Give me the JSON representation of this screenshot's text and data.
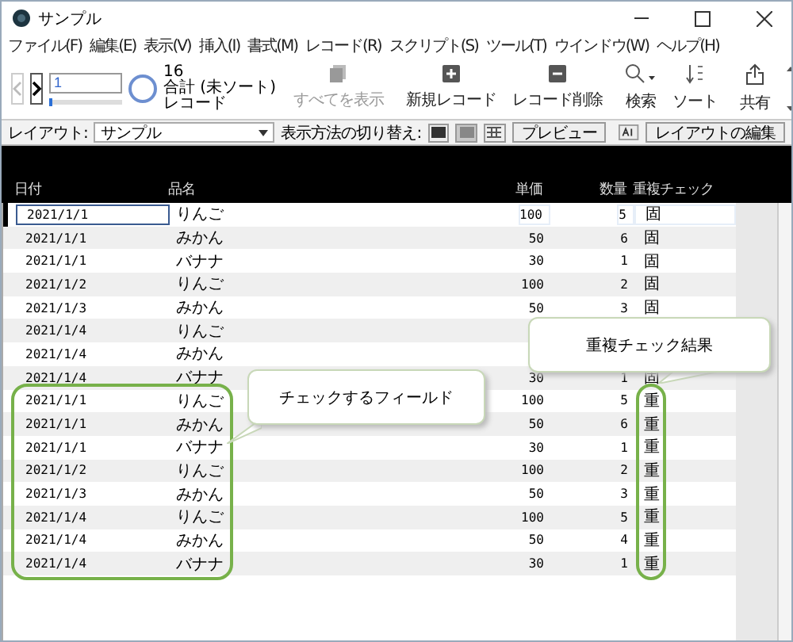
{
  "window": {
    "title": "サンプル"
  },
  "menu": [
    "ファイル(F)",
    "編集(E)",
    "表示(V)",
    "挿入(I)",
    "書式(M)",
    "レコード(R)",
    "スクリプト(S)",
    "ツール(T)",
    "ウインドウ(W)",
    "ヘルプ(H)"
  ],
  "toolbar": {
    "back_disabled": true,
    "record_number": "1",
    "record_slider": {
      "level": 0.05
    },
    "found_count": "16",
    "total_label": "合計 (未ソート)",
    "records_label": "レコード",
    "buttons": [
      {
        "kind": "show_all",
        "label": "すべてを表示",
        "disabled": true
      },
      {
        "kind": "new",
        "label": "新規レコード",
        "disabled": false
      },
      {
        "kind": "delete",
        "label": "レコード削除",
        "disabled": false
      },
      {
        "kind": "search",
        "label": "検索",
        "disabled": false
      },
      {
        "kind": "sort",
        "label": "ソート",
        "disabled": false
      },
      {
        "kind": "share",
        "label": "共有",
        "disabled": false
      }
    ]
  },
  "layout_bar": {
    "layout_label": "レイアウト:",
    "layout_value": "サンプル",
    "view_label": "表示方法の切り替え:",
    "views": [
      {
        "kind": "form",
        "selected": false
      },
      {
        "kind": "list",
        "selected": true
      },
      {
        "kind": "table",
        "selected": false
      }
    ],
    "preview": "プレビュー",
    "edit": "レイアウトの編集"
  },
  "table": {
    "columns": [
      "日付",
      "品名",
      "単価",
      "数量",
      "重複チェック"
    ],
    "rows": [
      {
        "date": "2021/1/1",
        "name": "りんご",
        "price": "100",
        "quantity": "5",
        "check": "固",
        "active": true
      },
      {
        "date": "2021/1/1",
        "name": "みかん",
        "price": "50",
        "quantity": "6",
        "check": "固",
        "active": false
      },
      {
        "date": "2021/1/1",
        "name": "バナナ",
        "price": "30",
        "quantity": "1",
        "check": "固",
        "active": false
      },
      {
        "date": "2021/1/2",
        "name": "りんご",
        "price": "100",
        "quantity": "2",
        "check": "固",
        "active": false
      },
      {
        "date": "2021/1/3",
        "name": "みかん",
        "price": "50",
        "quantity": "3",
        "check": "固",
        "active": false
      },
      {
        "date": "2021/1/4",
        "name": "りんご",
        "active": false
      },
      {
        "date": "2021/1/4",
        "name": "みかん",
        "active": false
      },
      {
        "date": "2021/1/4",
        "name": "バナナ",
        "price": "30",
        "quantity": "1",
        "check": "固",
        "active": false
      },
      {
        "date": "2021/1/1",
        "name": "りんご",
        "price": "100",
        "quantity": "5",
        "check": "重",
        "active": false
      },
      {
        "date": "2021/1/1",
        "name": "みかん",
        "price": "50",
        "quantity": "6",
        "check": "重",
        "active": false
      },
      {
        "date": "2021/1/1",
        "name": "バナナ",
        "price": "30",
        "quantity": "1",
        "check": "重",
        "active": false
      },
      {
        "date": "2021/1/2",
        "name": "りんご",
        "price": "100",
        "quantity": "2",
        "check": "重",
        "active": false
      },
      {
        "date": "2021/1/3",
        "name": "みかん",
        "price": "50",
        "quantity": "3",
        "check": "重",
        "active": false
      },
      {
        "date": "2021/1/4",
        "name": "りんご",
        "price": "100",
        "quantity": "5",
        "check": "重",
        "active": false
      },
      {
        "date": "2021/1/4",
        "name": "みかん",
        "price": "50",
        "quantity": "4",
        "check": "重",
        "active": false
      },
      {
        "date": "2021/1/4",
        "name": "バナナ",
        "price": "30",
        "quantity": "1",
        "check": "重",
        "active": false
      }
    ]
  },
  "callouts": [
    {
      "text": "チェックするフィールド"
    },
    {
      "text": "重複チェック結果"
    }
  ]
}
